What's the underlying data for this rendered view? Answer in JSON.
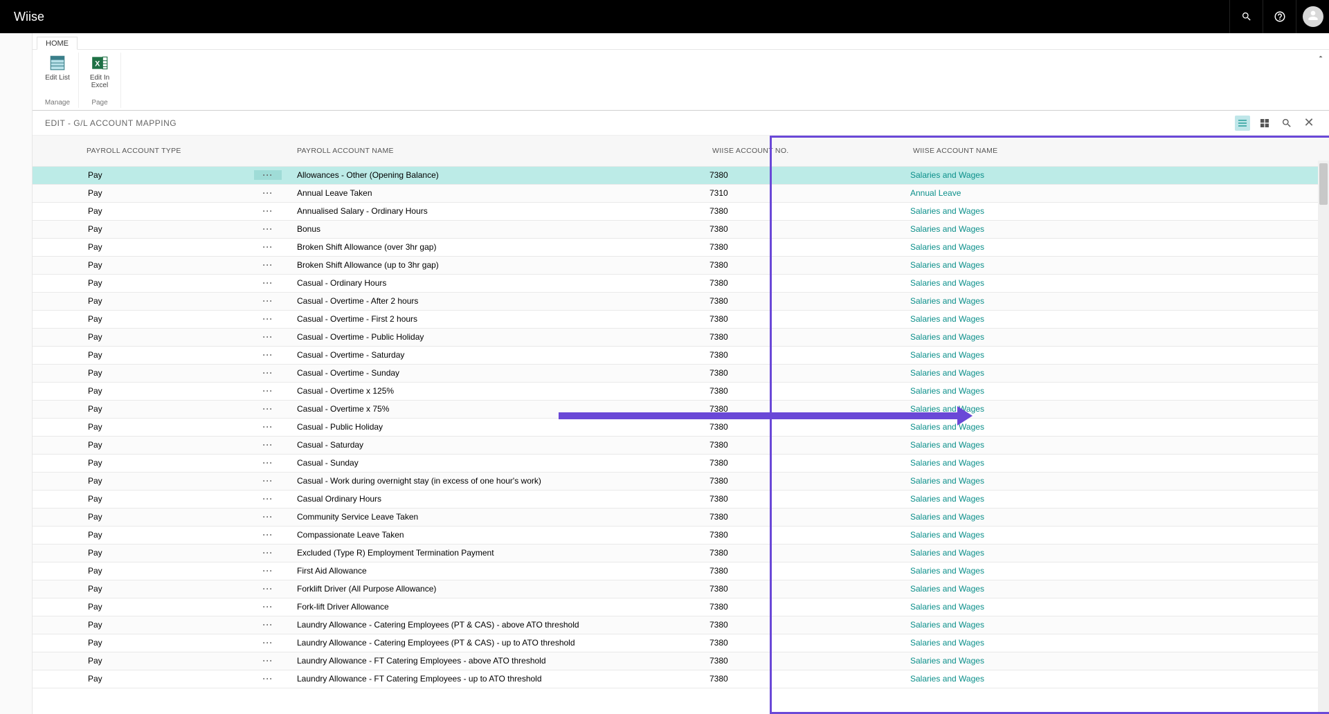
{
  "topbar": {
    "brand": "Wiise"
  },
  "ribbon": {
    "tab_home": "HOME",
    "edit_list_label": "Edit List",
    "edit_excel_label": "Edit In Excel",
    "group_manage": "Manage",
    "group_page": "Page"
  },
  "page": {
    "title": "EDIT - G/L ACCOUNT MAPPING"
  },
  "table": {
    "headers": {
      "type": "PAYROLL ACCOUNT TYPE",
      "name": "PAYROLL ACCOUNT NAME",
      "no": "WIISE ACCOUNT NO.",
      "wname": "WIISE ACCOUNT NAME"
    },
    "rows": [
      {
        "type": "Pay",
        "name": "Allowances - Other (Opening Balance)",
        "no": "7380",
        "wname": "Salaries and Wages",
        "selected": true
      },
      {
        "type": "Pay",
        "name": "Annual Leave Taken",
        "no": "7310",
        "wname": "Annual Leave"
      },
      {
        "type": "Pay",
        "name": "Annualised Salary - Ordinary Hours",
        "no": "7380",
        "wname": "Salaries and Wages"
      },
      {
        "type": "Pay",
        "name": "Bonus",
        "no": "7380",
        "wname": "Salaries and Wages"
      },
      {
        "type": "Pay",
        "name": "Broken Shift Allowance (over 3hr gap)",
        "no": "7380",
        "wname": "Salaries and Wages"
      },
      {
        "type": "Pay",
        "name": "Broken Shift Allowance (up to 3hr gap)",
        "no": "7380",
        "wname": "Salaries and Wages"
      },
      {
        "type": "Pay",
        "name": "Casual - Ordinary Hours",
        "no": "7380",
        "wname": "Salaries and Wages"
      },
      {
        "type": "Pay",
        "name": "Casual - Overtime - After 2 hours",
        "no": "7380",
        "wname": "Salaries and Wages"
      },
      {
        "type": "Pay",
        "name": "Casual - Overtime - First 2 hours",
        "no": "7380",
        "wname": "Salaries and Wages"
      },
      {
        "type": "Pay",
        "name": "Casual - Overtime - Public Holiday",
        "no": "7380",
        "wname": "Salaries and Wages"
      },
      {
        "type": "Pay",
        "name": "Casual - Overtime - Saturday",
        "no": "7380",
        "wname": "Salaries and Wages"
      },
      {
        "type": "Pay",
        "name": "Casual - Overtime - Sunday",
        "no": "7380",
        "wname": "Salaries and Wages"
      },
      {
        "type": "Pay",
        "name": "Casual - Overtime x 125%",
        "no": "7380",
        "wname": "Salaries and Wages"
      },
      {
        "type": "Pay",
        "name": "Casual - Overtime x 75%",
        "no": "7380",
        "wname": "Salaries and Wages"
      },
      {
        "type": "Pay",
        "name": "Casual - Public Holiday",
        "no": "7380",
        "wname": "Salaries and Wages"
      },
      {
        "type": "Pay",
        "name": "Casual - Saturday",
        "no": "7380",
        "wname": "Salaries and Wages"
      },
      {
        "type": "Pay",
        "name": "Casual - Sunday",
        "no": "7380",
        "wname": "Salaries and Wages"
      },
      {
        "type": "Pay",
        "name": "Casual - Work during overnight stay (in excess of one hour's work)",
        "no": "7380",
        "wname": "Salaries and Wages"
      },
      {
        "type": "Pay",
        "name": "Casual Ordinary Hours",
        "no": "7380",
        "wname": "Salaries and Wages"
      },
      {
        "type": "Pay",
        "name": "Community Service Leave Taken",
        "no": "7380",
        "wname": "Salaries and Wages"
      },
      {
        "type": "Pay",
        "name": "Compassionate Leave Taken",
        "no": "7380",
        "wname": "Salaries and Wages"
      },
      {
        "type": "Pay",
        "name": "Excluded (Type R) Employment Termination Payment",
        "no": "7380",
        "wname": "Salaries and Wages"
      },
      {
        "type": "Pay",
        "name": "First Aid Allowance",
        "no": "7380",
        "wname": "Salaries and Wages"
      },
      {
        "type": "Pay",
        "name": "Forklift Driver (All Purpose Allowance)",
        "no": "7380",
        "wname": "Salaries and Wages"
      },
      {
        "type": "Pay",
        "name": "Fork-lift Driver Allowance",
        "no": "7380",
        "wname": "Salaries and Wages"
      },
      {
        "type": "Pay",
        "name": "Laundry Allowance - Catering Employees (PT & CAS) - above ATO threshold",
        "no": "7380",
        "wname": "Salaries and Wages"
      },
      {
        "type": "Pay",
        "name": "Laundry Allowance - Catering Employees (PT & CAS) - up to ATO threshold",
        "no": "7380",
        "wname": "Salaries and Wages"
      },
      {
        "type": "Pay",
        "name": "Laundry Allowance - FT Catering Employees - above ATO threshold",
        "no": "7380",
        "wname": "Salaries and Wages"
      },
      {
        "type": "Pay",
        "name": "Laundry Allowance - FT Catering Employees - up to ATO threshold",
        "no": "7380",
        "wname": "Salaries and Wages"
      }
    ]
  }
}
